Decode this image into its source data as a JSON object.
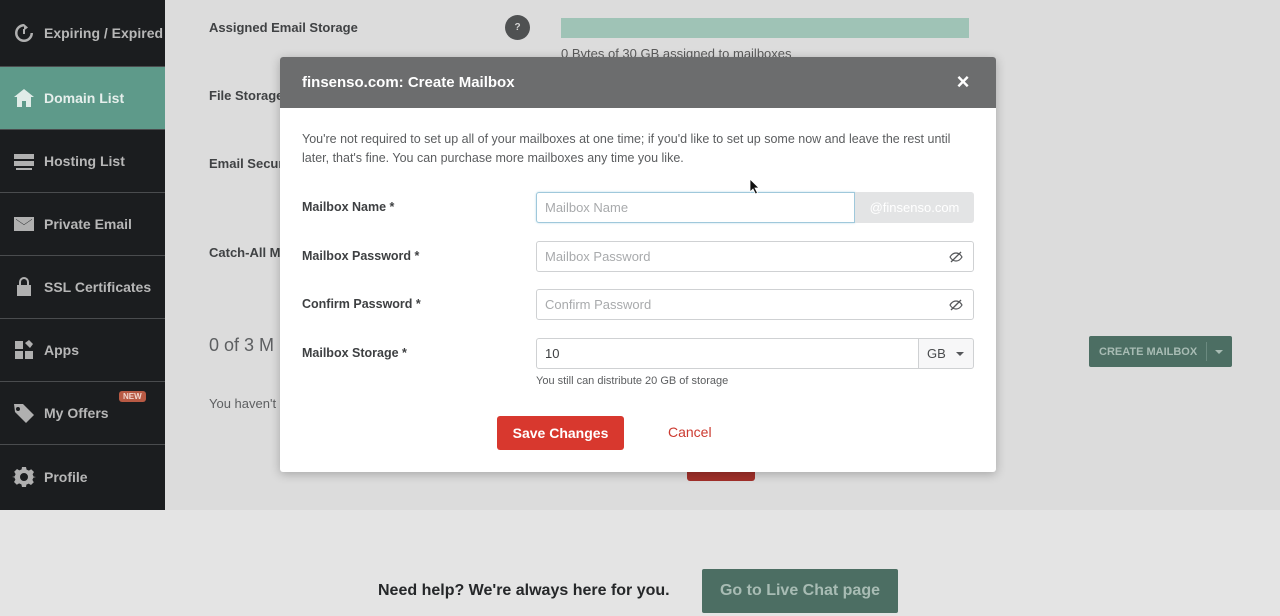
{
  "sidebar": {
    "items": [
      {
        "label": "Expiring / Expired",
        "icon": "timer-icon"
      },
      {
        "label": "Domain List",
        "icon": "home-icon",
        "active": true
      },
      {
        "label": "Hosting List",
        "icon": "server-icon"
      },
      {
        "label": "Private Email",
        "icon": "envelope-icon"
      },
      {
        "label": "SSL Certificates",
        "icon": "lock-icon"
      },
      {
        "label": "Apps",
        "icon": "apps-grid-icon"
      },
      {
        "label": "My Offers",
        "icon": "tag-icon",
        "badge": "NEW"
      },
      {
        "label": "Profile",
        "icon": "gear-icon"
      }
    ]
  },
  "background": {
    "assigned_email_storage": "Assigned Email Storage",
    "help_q": "?",
    "storage_text": "0 Bytes of 30 GB assigned to mailboxes",
    "file_storage": "File Storage",
    "email_security": "Email Secur",
    "catch_all": "Catch-All M",
    "count_text": "0 of 3 M",
    "havent_text": "You haven't",
    "create_mailbox": "CREATE MAILBOX"
  },
  "footer": {
    "help_text": "Need help? We're always here for you.",
    "chat_button": "Go to Live Chat page"
  },
  "modal": {
    "title": "finsenso.com: Create Mailbox",
    "close": "×",
    "intro": "You're not required to set up all of your mailboxes at one time; if you'd like to set up some now and leave the rest until later, that's fine. You can purchase more mailboxes any time you like.",
    "mailbox_name_label": "Mailbox Name *",
    "mailbox_name_placeholder": "Mailbox Name",
    "domain_suffix": "@finsenso.com",
    "password_label": "Mailbox Password *",
    "password_placeholder": "Mailbox Password",
    "confirm_label": "Confirm Password *",
    "confirm_placeholder": "Confirm Password",
    "storage_label": "Mailbox Storage *",
    "storage_value": "10",
    "storage_unit": "GB",
    "storage_hint": "You still can distribute 20 GB of storage",
    "save_button": "Save Changes",
    "cancel_button": "Cancel"
  },
  "colors": {
    "sidebar_bg": "#1b1d1f",
    "active_green": "#5e9a8a",
    "save_red": "#d8382e",
    "modal_header": "#6c6d6e"
  }
}
